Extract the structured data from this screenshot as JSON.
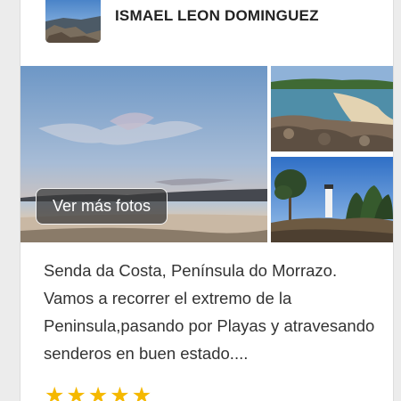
{
  "post": {
    "author_name": "ISMAEL LEON DOMINGUEZ",
    "gallery": {
      "more_photos_label": "Ver más fotos",
      "photos": [
        "sunset-beach-photo",
        "cove-beach-photo",
        "lighthouse-pines-photo"
      ]
    },
    "description": "Senda da Costa, Península do Morrazo. Vamos a recorrer el extremo de la Peninsula,pasando por Playas y atravesando senderos en buen estado....",
    "rating": {
      "value": 5,
      "max": 5,
      "star_glyph": "★",
      "star_color": "#f5b800"
    }
  }
}
